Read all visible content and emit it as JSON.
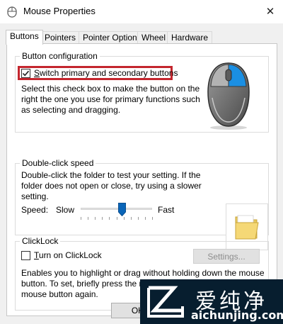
{
  "window": {
    "title": "Mouse Properties",
    "close_glyph": "✕"
  },
  "tabs": [
    {
      "label": "Buttons",
      "active": true
    },
    {
      "label": "Pointers",
      "active": false
    },
    {
      "label": "Pointer Options",
      "active": false
    },
    {
      "label": "Wheel",
      "active": false
    },
    {
      "label": "Hardware",
      "active": false
    }
  ],
  "button_configuration": {
    "title": "Button configuration",
    "checkbox_label": "Switch primary and secondary buttons",
    "checkbox_accel": "S",
    "checkbox_label_rest": "witch primary and secondary buttons",
    "checked": true,
    "description_lines": [
      "Select this check box to make the button on the",
      "right the one you use for primary functions such",
      "as selecting and dragging."
    ]
  },
  "double_click": {
    "title": "Double-click speed",
    "description_lines": [
      "Double-click the folder to test your setting. If the",
      "folder does not open or close, try using a slower",
      "setting."
    ],
    "speed_label": "Speed:",
    "speed_accel": "D",
    "slow_label": "Slow",
    "fast_label": "Fast",
    "speed_value_fraction": 0.58
  },
  "clicklock": {
    "title": "ClickLock",
    "checkbox_accel": "T",
    "checkbox_label_rest": "urn on ClickLock",
    "checked": false,
    "settings_label": "Settings...",
    "description_lines": [
      "Enables you to highlight or drag without holding down the mouse",
      "button. To set, briefly press the mouse button. To release, click the",
      "mouse button again."
    ]
  },
  "footer": {
    "ok_label": "OK"
  },
  "watermark": {
    "cn_text": "爱纯净",
    "url_text": "aichunjing.com"
  },
  "colors": {
    "highlight": "#c4262e",
    "mouse_accent": "#1a8fe3",
    "watermark_bg": "#071e2f",
    "slider_thumb": "#0a65b8"
  },
  "icons": {
    "title": "mouse-icon",
    "close": "close-icon",
    "mouse_illustration": "mouse-illustration-icon",
    "folder": "folder-icon",
    "watermark_logo": "logo-icon"
  }
}
